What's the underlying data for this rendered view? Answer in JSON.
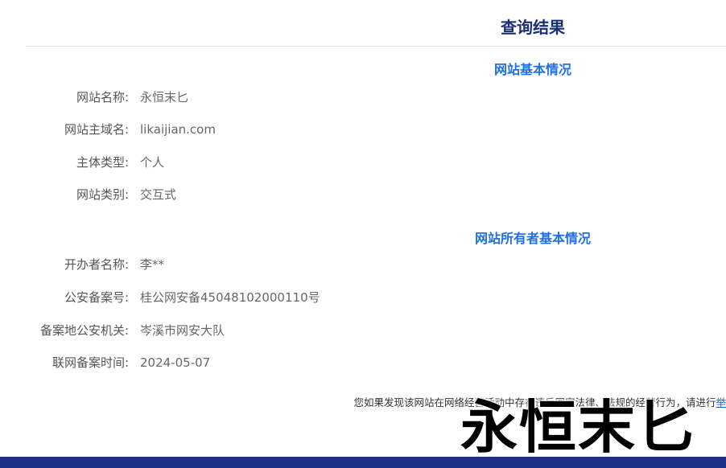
{
  "page": {
    "title": "查询结果"
  },
  "site_info": {
    "heading": "网站基本情况",
    "rows": [
      {
        "label": "网站名称:",
        "value": "永恒末匕"
      },
      {
        "label": "网站主域名:",
        "value": "likaijian.com"
      },
      {
        "label": "主体类型:",
        "value": "个人"
      },
      {
        "label": "网站类别:",
        "value": "交互式"
      }
    ]
  },
  "owner_info": {
    "heading": "网站所有者基本情况",
    "rows": [
      {
        "label": "开办者名称:",
        "value": "李**"
      },
      {
        "label": "公安备案号:",
        "value": "桂公网安备45048102000110号"
      },
      {
        "label": "备案地公安机关:",
        "value": "岑溪市网安大队"
      },
      {
        "label": "联网备案时间:",
        "value": "2024-05-07"
      }
    ]
  },
  "notice": {
    "text": "您如果发现该网站在网络经营活动中存在违反国家法律、法规的经营行为，请进行",
    "link_label": "举"
  },
  "watermark": {
    "text": "永恒末匕"
  },
  "colors": {
    "title": "#1b2f73",
    "section_heading": "#1f6fe5",
    "footer": "#1b2f86"
  }
}
